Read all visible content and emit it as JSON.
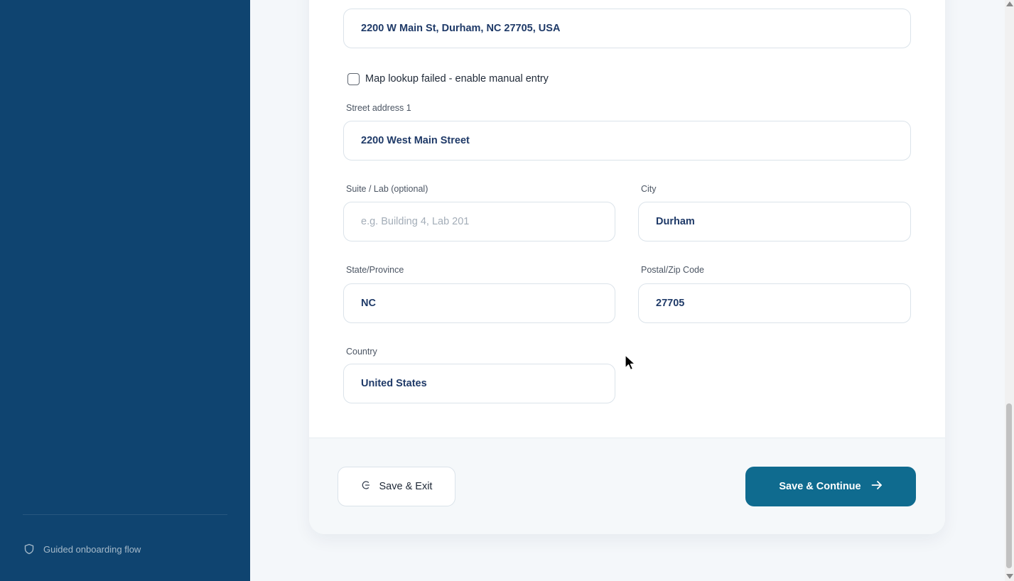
{
  "sidebar": {
    "footer_text": "Guided onboarding flow",
    "footer_icon": "shield-icon"
  },
  "form": {
    "address_lookup": {
      "value": "2200 W Main St, Durham, NC 27705, USA"
    },
    "manual_entry": {
      "label": "Map lookup failed - enable manual entry",
      "checked": false
    },
    "street_address_1": {
      "label": "Street address 1",
      "value": "2200 West Main Street"
    },
    "suite": {
      "label": "Suite / Lab (optional)",
      "placeholder": "e.g. Building 4, Lab 201",
      "value": ""
    },
    "city": {
      "label": "City",
      "value": "Durham"
    },
    "state": {
      "label": "State/Province",
      "value": "NC"
    },
    "postal": {
      "label": "Postal/Zip Code",
      "value": "27705"
    },
    "country": {
      "label": "Country",
      "value": "United States"
    }
  },
  "actions": {
    "save_exit_label": "Save & Exit",
    "save_exit_icon": "exit-icon",
    "save_continue_label": "Save & Continue",
    "save_continue_icon": "arrow-right-icon"
  },
  "colors": {
    "sidebar_bg": "#0f4470",
    "primary_button": "#0f6b8f",
    "input_text": "#1f3a68"
  }
}
